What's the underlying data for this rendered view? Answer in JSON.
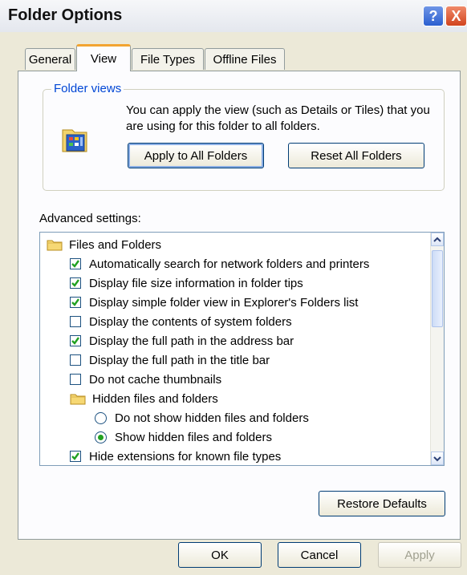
{
  "window": {
    "title": "Folder Options",
    "help_label": "?",
    "close_label": "X"
  },
  "tabs": [
    {
      "label": "General",
      "active": false
    },
    {
      "label": "View",
      "active": true
    },
    {
      "label": "File Types",
      "active": false
    },
    {
      "label": "Offline Files",
      "active": false
    }
  ],
  "folder_views": {
    "group_label": "Folder views",
    "description": "You can apply the view (such as Details or Tiles) that you are using for this folder to all folders.",
    "apply_all_label": "Apply to All Folders",
    "reset_all_label": "Reset All Folders"
  },
  "advanced": {
    "label": "Advanced settings:",
    "items": [
      {
        "type": "folder",
        "label": "Files and Folders",
        "indent": 0
      },
      {
        "type": "checkbox",
        "label": "Automatically search for network folders and printers",
        "checked": true,
        "indent": 1
      },
      {
        "type": "checkbox",
        "label": "Display file size information in folder tips",
        "checked": true,
        "indent": 1
      },
      {
        "type": "checkbox",
        "label": "Display simple folder view in Explorer's Folders list",
        "checked": true,
        "indent": 1
      },
      {
        "type": "checkbox",
        "label": "Display the contents of system folders",
        "checked": false,
        "indent": 1
      },
      {
        "type": "checkbox",
        "label": "Display the full path in the address bar",
        "checked": true,
        "indent": 1
      },
      {
        "type": "checkbox",
        "label": "Display the full path in the title bar",
        "checked": false,
        "indent": 1
      },
      {
        "type": "checkbox",
        "label": "Do not cache thumbnails",
        "checked": false,
        "indent": 1
      },
      {
        "type": "folder",
        "label": "Hidden files and folders",
        "indent": 1
      },
      {
        "type": "radio",
        "label": "Do not show hidden files and folders",
        "selected": false,
        "indent": 2
      },
      {
        "type": "radio",
        "label": "Show hidden files and folders",
        "selected": true,
        "indent": 2
      },
      {
        "type": "checkbox",
        "label": "Hide extensions for known file types",
        "checked": true,
        "indent": 1
      }
    ]
  },
  "buttons": {
    "restore_defaults": "Restore Defaults",
    "ok": "OK",
    "cancel": "Cancel",
    "apply": "Apply"
  },
  "colors": {
    "highlight": "#ffff33",
    "group_label": "#0046d5",
    "check": "#21a121"
  }
}
